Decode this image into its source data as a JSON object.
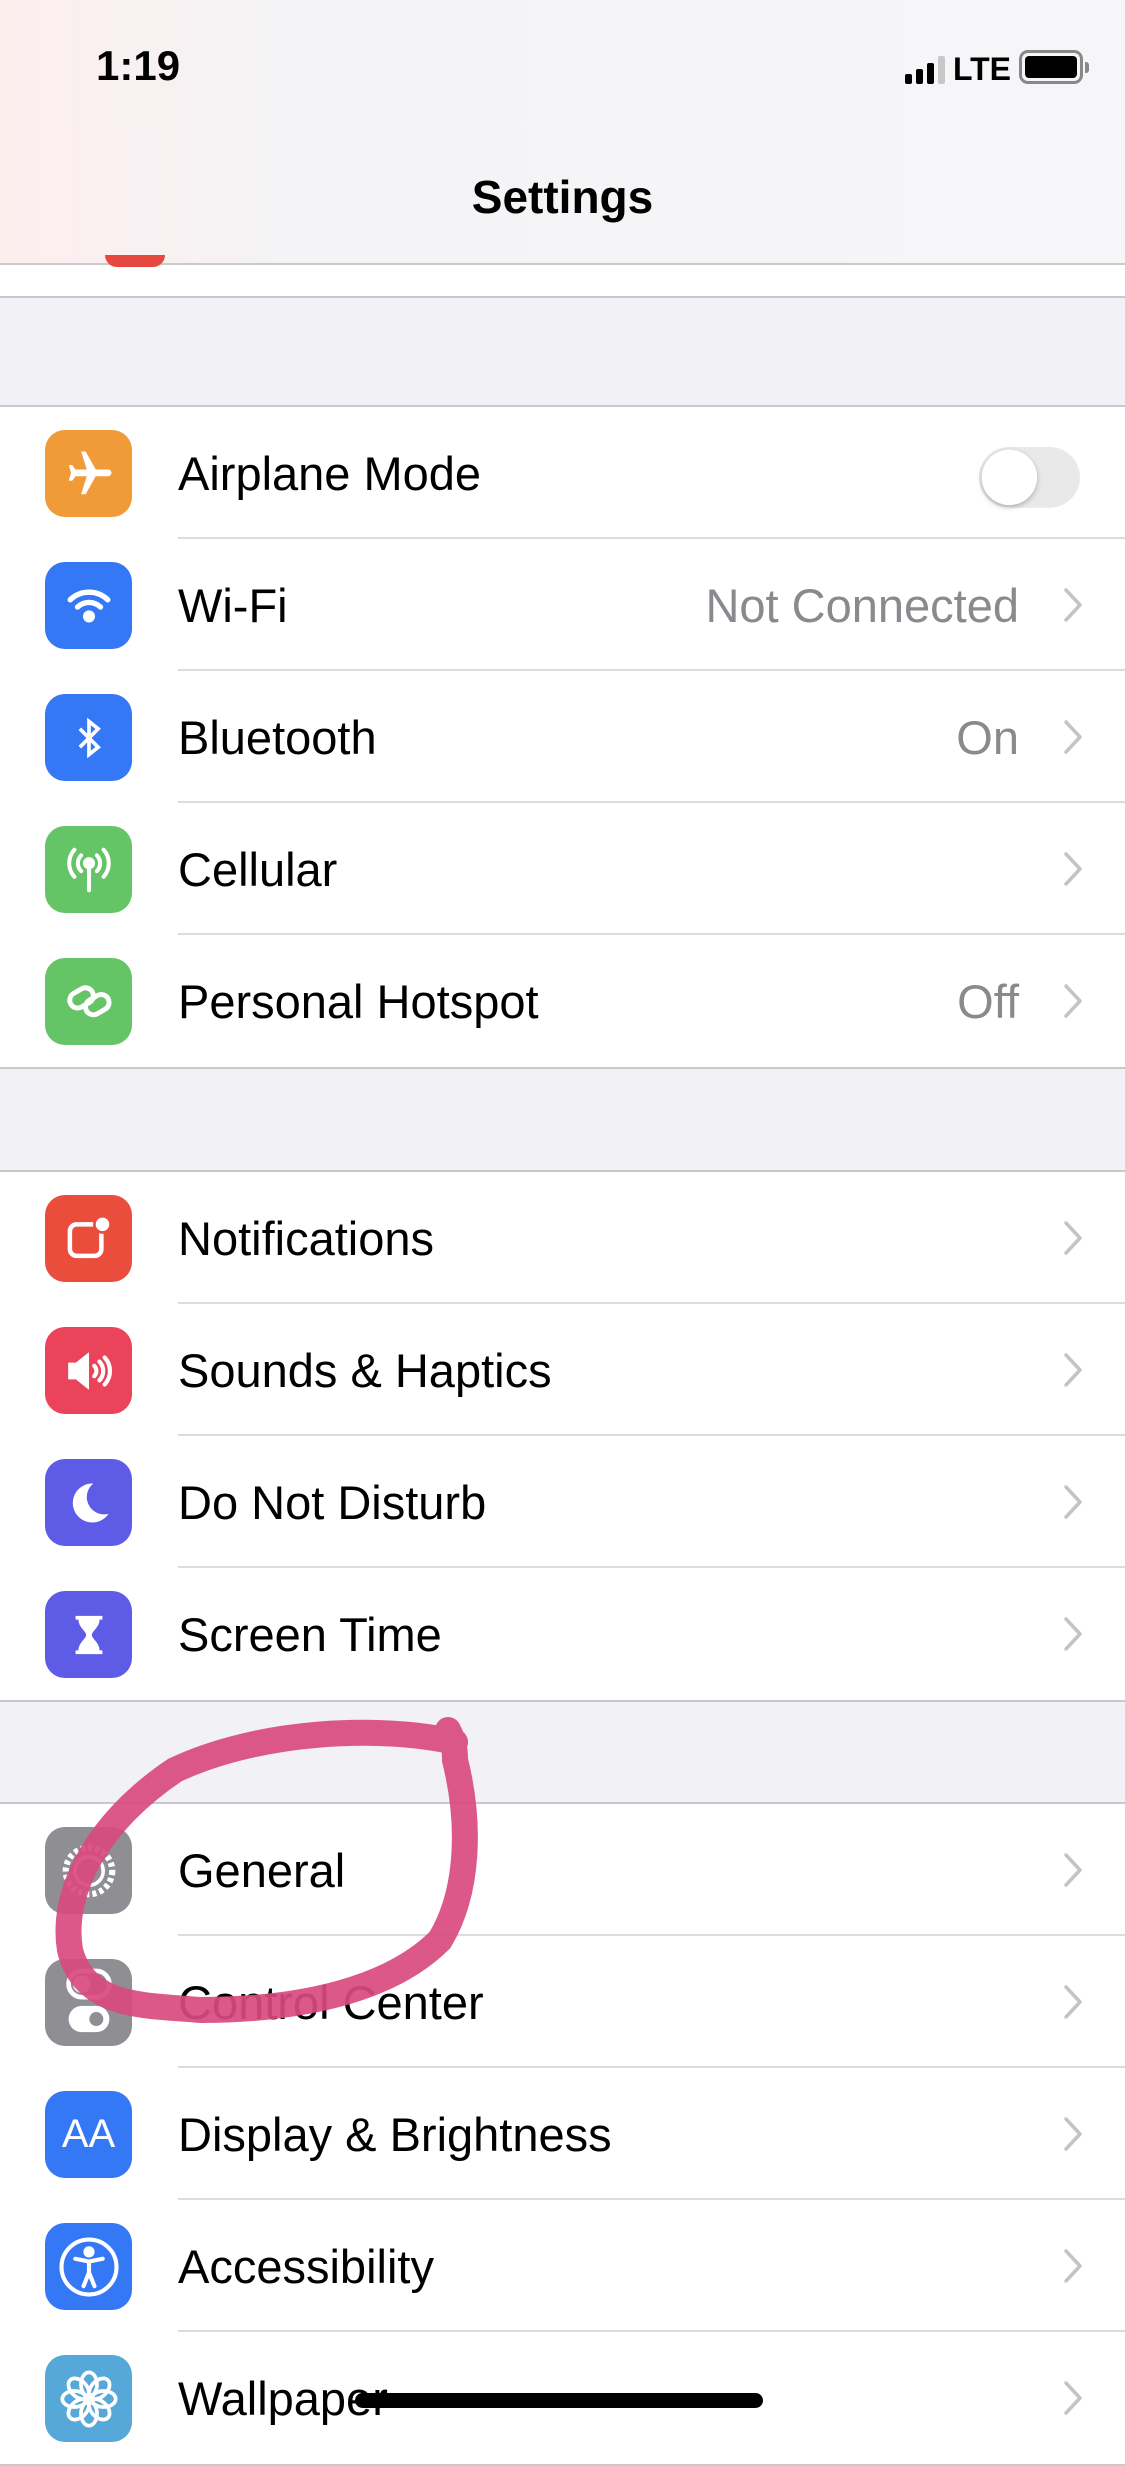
{
  "status_bar": {
    "time": "1:19",
    "network": "LTE",
    "signal_bars": 3,
    "battery_level": 0.9
  },
  "header": {
    "title": "Settings"
  },
  "groups": [
    {
      "rows": [
        {
          "label": "Airplane Mode",
          "icon": "airplane-icon",
          "color": "#f19a38",
          "toggle": false
        },
        {
          "label": "Wi-Fi",
          "icon": "wifi-icon",
          "color": "#3478f6",
          "value": "Not Connected"
        },
        {
          "label": "Bluetooth",
          "icon": "bluetooth-icon",
          "color": "#3478f6",
          "value": "On"
        },
        {
          "label": "Cellular",
          "icon": "cellular-icon",
          "color": "#65c466"
        },
        {
          "label": "Personal Hotspot",
          "icon": "hotspot-icon",
          "color": "#65c466",
          "value": "Off"
        }
      ]
    },
    {
      "rows": [
        {
          "label": "Notifications",
          "icon": "notifications-icon",
          "color": "#eb4d3d"
        },
        {
          "label": "Sounds & Haptics",
          "icon": "speaker-icon",
          "color": "#eb445a"
        },
        {
          "label": "Do Not Disturb",
          "icon": "moon-icon",
          "color": "#5e5ce6"
        },
        {
          "label": "Screen Time",
          "icon": "hourglass-icon",
          "color": "#5e5ce6"
        }
      ]
    },
    {
      "rows": [
        {
          "label": "General",
          "icon": "gear-icon",
          "color": "#8e8e93"
        },
        {
          "label": "Control Center",
          "icon": "switches-icon",
          "color": "#8e8e93"
        },
        {
          "label": "Display & Brightness",
          "icon": "text-size-icon",
          "color": "#3478f6",
          "icon_text": "AA"
        },
        {
          "label": "Accessibility",
          "icon": "accessibility-icon",
          "color": "#3478f6"
        },
        {
          "label": "Wallpaper",
          "icon": "flower-icon",
          "color": "#55a8d8"
        }
      ]
    }
  ],
  "annotation": {
    "color": "#d94a7e"
  }
}
